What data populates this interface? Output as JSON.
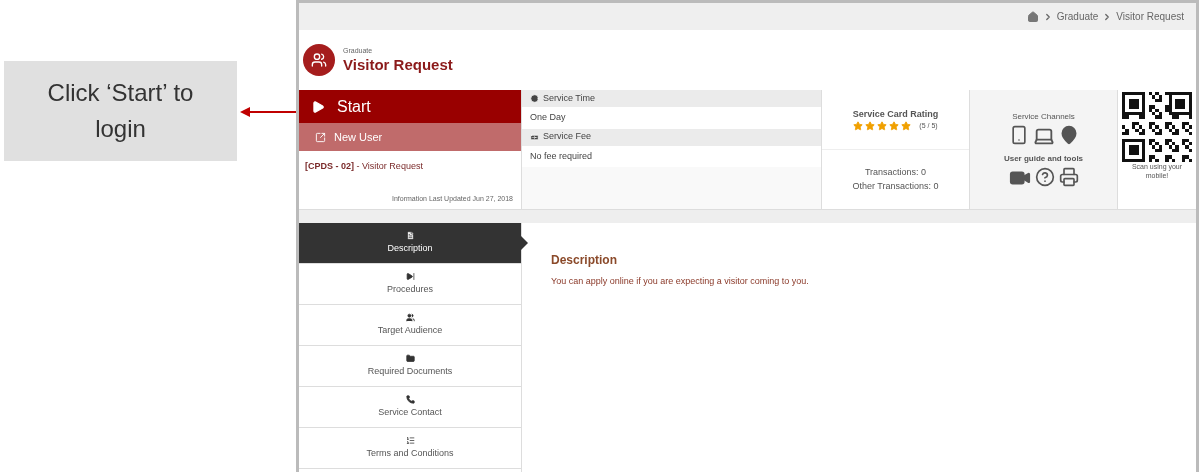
{
  "callout": {
    "text": "Click ‘Start’ to login"
  },
  "breadcrumb": [
    "Graduate",
    "Visitor Request"
  ],
  "header": {
    "category": "Graduate",
    "title": "Visitor Request"
  },
  "start_button": "Start",
  "new_user_button": "New User",
  "service_code": "[CPDS - 02]",
  "service_name": "- Visitor Request",
  "last_updated": "Information Last Updated Jun 27, 2018",
  "info": [
    {
      "kind": "time",
      "label": "Service Time",
      "value": "One Day"
    },
    {
      "kind": "fee",
      "label": "Service Fee",
      "value": "No fee required"
    }
  ],
  "rating": {
    "title": "Service Card Rating",
    "stars": 5,
    "score": "(5 / 5)",
    "transactions": "Transactions: 0",
    "other_transactions": "Other Transactions: 0"
  },
  "channels": {
    "title": "Service Channels",
    "tools_title": "User guide and tools"
  },
  "qr": {
    "caption": "Scan using your mobile!"
  },
  "tabs": [
    {
      "kind": "description",
      "label": "Description",
      "selected": true
    },
    {
      "kind": "procedures",
      "label": "Procedures",
      "selected": false
    },
    {
      "kind": "audience",
      "label": "Target Audience",
      "selected": false
    },
    {
      "kind": "documents",
      "label": "Required Documents",
      "selected": false
    },
    {
      "kind": "contact",
      "label": "Service Contact",
      "selected": false
    },
    {
      "kind": "terms",
      "label": "Terms and Conditions",
      "selected": false
    }
  ],
  "content": {
    "title": "Description",
    "text": "You can apply online if you are expecting a visitor coming to you."
  }
}
